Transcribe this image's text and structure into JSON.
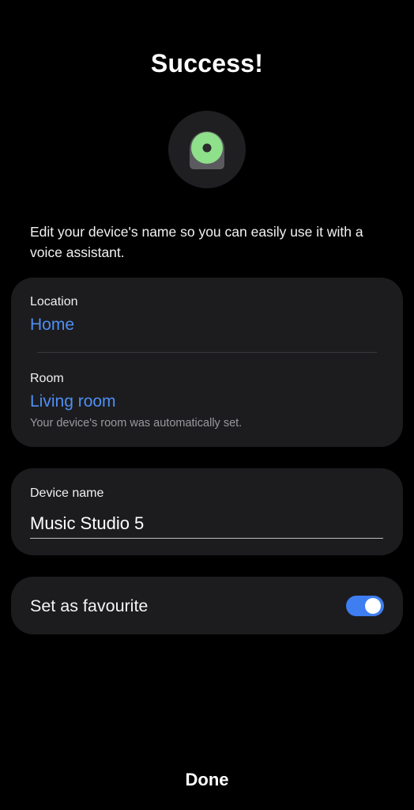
{
  "header": {
    "title": "Success!"
  },
  "device_icon": {
    "name": "speaker-device-icon",
    "accent_color": "#8ee08a",
    "body_color": "#5b5b5f"
  },
  "intro_text": "Edit your device's name so you can easily use it with a voice assistant.",
  "location_card": {
    "location_label": "Location",
    "location_value": "Home",
    "room_label": "Room",
    "room_value": "Living room",
    "room_hint": "Your device's room was automatically set."
  },
  "device_name_card": {
    "label": "Device name",
    "value": "Music Studio 5"
  },
  "favourite_card": {
    "label": "Set as favourite",
    "toggle_on": true,
    "toggle_color": "#3e7ef0"
  },
  "footer": {
    "done_label": "Done"
  },
  "colors": {
    "background": "#000000",
    "card": "#1c1c1f",
    "link": "#4f8ff2"
  }
}
